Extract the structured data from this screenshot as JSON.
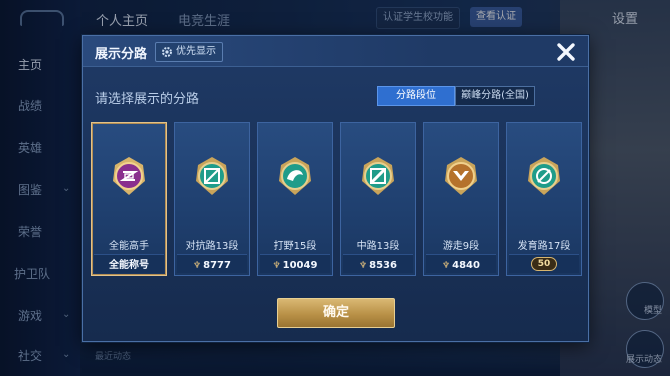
{
  "background": {
    "sidebar_items": [
      "主页",
      "战绩",
      "英雄",
      "图鉴",
      "荣誉",
      "护卫队",
      "游戏",
      "社交"
    ],
    "top_tabs": [
      "个人主页",
      "电竞生涯"
    ],
    "verify_text": "认证学生校功能",
    "verify_badge": "查看认证",
    "settings": "设置",
    "bottom_text": "最近动态",
    "right_btn_1": "模型",
    "right_btn_2": "展示动态"
  },
  "dialog": {
    "title": "展示分路",
    "priority_label": "优先显示",
    "subtitle": "请选择展示的分路",
    "segments": [
      {
        "label": "分路段位",
        "active": true
      },
      {
        "label": "巅峰分路(全国)",
        "active": false
      }
    ],
    "cards": [
      {
        "name": "全能高手",
        "score": "全能称号",
        "icon": "all-round-master-icon",
        "selected": true
      },
      {
        "name": "对抗路13段",
        "score": "8777",
        "icon": "clash-lane-icon",
        "selected": false
      },
      {
        "name": "打野15段",
        "score": "10049",
        "icon": "jungle-icon",
        "selected": false
      },
      {
        "name": "中路13段",
        "score": "8536",
        "icon": "mid-lane-icon",
        "selected": false
      },
      {
        "name": "游走9段",
        "score": "4840",
        "icon": "roam-icon",
        "selected": false
      },
      {
        "name": "发育路17段",
        "score": "50",
        "icon": "farm-lane-icon",
        "selected": false
      }
    ],
    "confirm_label": "确定"
  },
  "colors": {
    "accent_blue": "#2f6fd0",
    "gold": "#d9b873",
    "dialog_bg": "#1f3a66"
  }
}
